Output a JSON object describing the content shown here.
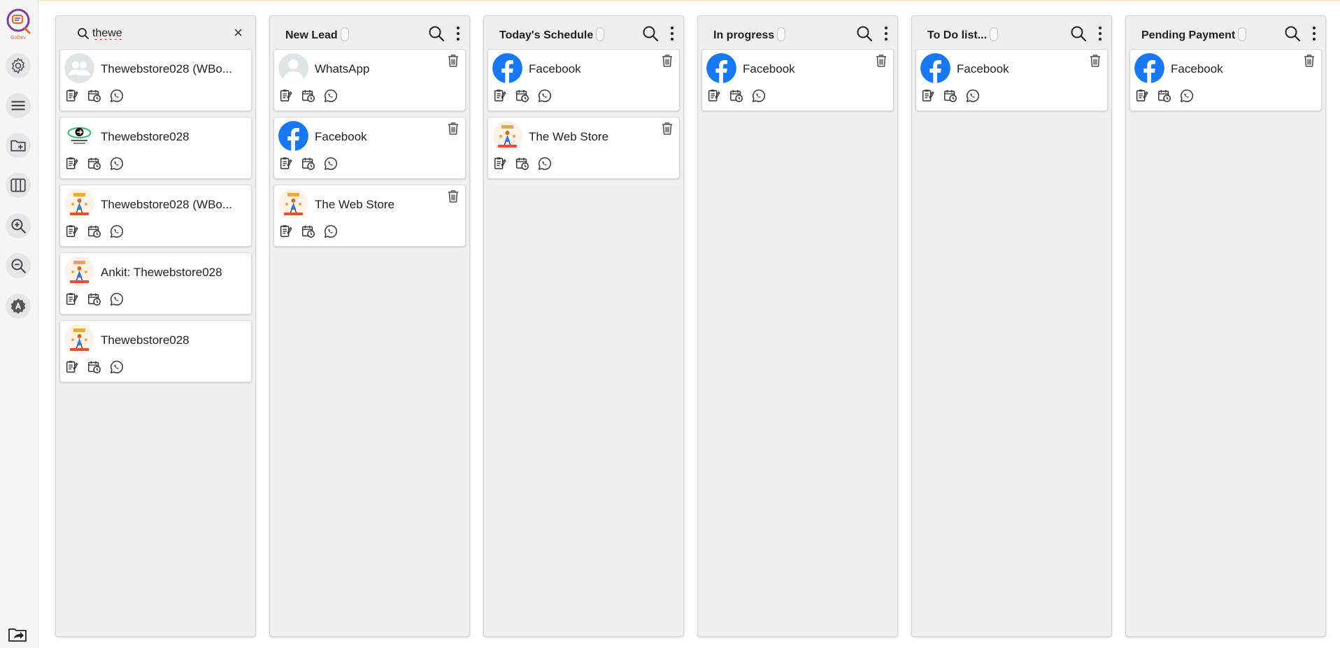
{
  "app": {
    "logo_label": "GoDev"
  },
  "sidebar": {
    "items": [
      {
        "name": "settings",
        "icon": "gear-icon"
      },
      {
        "name": "menu",
        "icon": "hamburger-icon"
      },
      {
        "name": "new-folder",
        "icon": "folder-add-icon"
      },
      {
        "name": "board-view",
        "icon": "columns-icon"
      },
      {
        "name": "zoom-in",
        "icon": "zoom-in-icon"
      },
      {
        "name": "zoom-out",
        "icon": "zoom-out-icon"
      },
      {
        "name": "auto",
        "icon": "letter-a-icon"
      }
    ],
    "bottom_icon": "folder-share-icon"
  },
  "search": {
    "value": "thewe",
    "clear_label": "×"
  },
  "colors": {
    "facebook": "#1877f2",
    "column_bg": "#efefef",
    "icon": "#3b3b3b"
  },
  "columns": [
    {
      "title": "",
      "is_search": true,
      "cards": [
        {
          "name": "Thewebstore028 (WBo...",
          "avatar": "group"
        },
        {
          "name": "Thewebstore028",
          "avatar": "logo-green"
        },
        {
          "name": "Thewebstore028 (WBo...",
          "avatar": "store"
        },
        {
          "name": "Ankit: Thewebstore028",
          "avatar": "store"
        },
        {
          "name": "Thewebstore028",
          "avatar": "store"
        }
      ]
    },
    {
      "title": "New Lead",
      "cards": [
        {
          "name": "WhatsApp",
          "avatar": "person"
        },
        {
          "name": "Facebook",
          "avatar": "facebook"
        },
        {
          "name": "The Web Store",
          "avatar": "store"
        }
      ]
    },
    {
      "title": "Today's Schedule",
      "cards": [
        {
          "name": "Facebook",
          "avatar": "facebook"
        },
        {
          "name": "The Web Store",
          "avatar": "store"
        }
      ]
    },
    {
      "title": "In progress",
      "cards": [
        {
          "name": "Facebook",
          "avatar": "facebook"
        }
      ]
    },
    {
      "title": "To Do list...",
      "cards": [
        {
          "name": "Facebook",
          "avatar": "facebook"
        }
      ]
    },
    {
      "title": "Pending Payment",
      "cards": [
        {
          "name": "Facebook",
          "avatar": "facebook"
        }
      ]
    }
  ]
}
